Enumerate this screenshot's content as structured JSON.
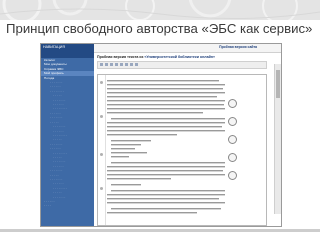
{
  "slide": {
    "title": "Принцип свободного авторства «ЭБС как сервис»"
  },
  "screenshot": {
    "header": {
      "site_label": "Пробная версия сайта"
    },
    "sidebar": {
      "title": "НАВИГАЦИЯ",
      "items": [
        {
          "label": "Каталог"
        },
        {
          "label": "Мои документы"
        },
        {
          "label": "Справка ЭБС"
        },
        {
          "label": "Мой профиль"
        },
        {
          "label": "Погода"
        }
      ]
    },
    "document": {
      "heading_prefix": "Пробная версия текста из",
      "heading_source": "«Университетской библиотеки онлайн»",
      "page_label": "1"
    }
  },
  "colors": {
    "sidebar_bg": "#3e6aa6",
    "sidebar_head": "#234a84",
    "title_text": "#3a3a3a"
  }
}
